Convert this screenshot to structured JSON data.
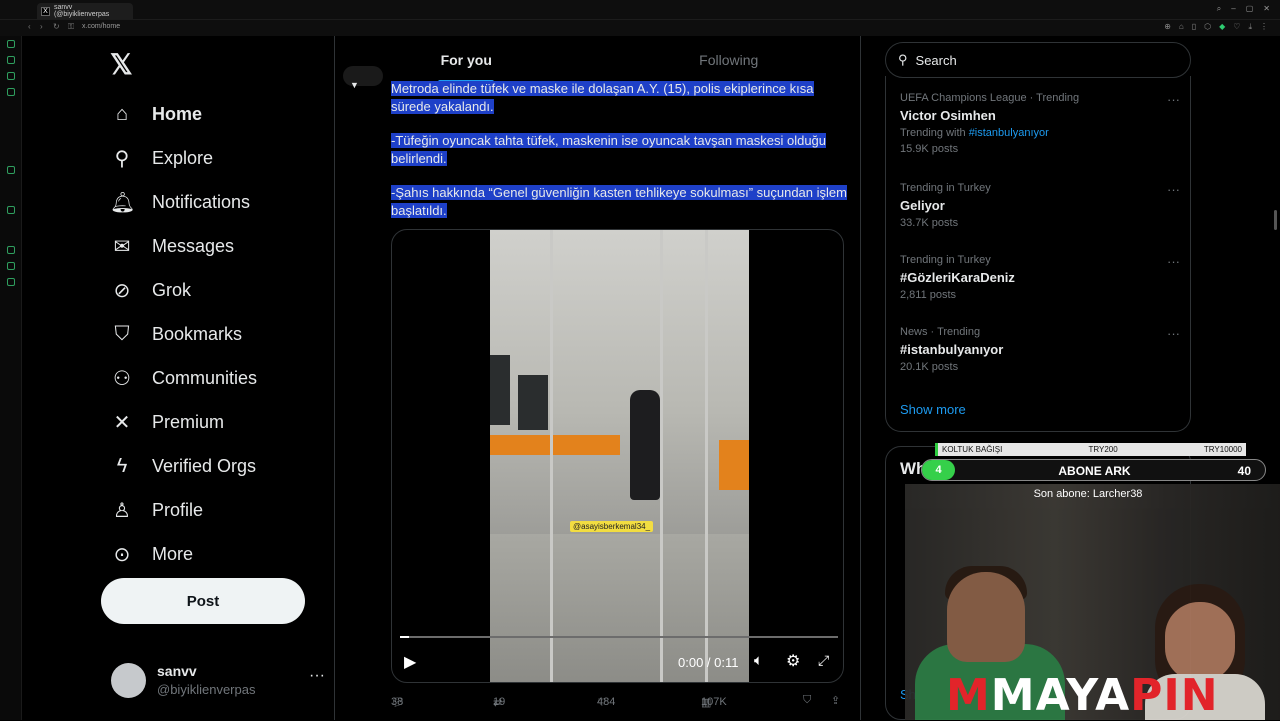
{
  "browser": {
    "tab_title": "sanvv (@biyiklienverpas",
    "tab_favicon": "x-logo",
    "address": "x.com/home"
  },
  "left_nav": {
    "logo": "𝕏",
    "items": [
      {
        "label": "Home",
        "icon": "home-icon",
        "active": true
      },
      {
        "label": "Explore",
        "icon": "search-icon"
      },
      {
        "label": "Notifications",
        "icon": "bell-icon"
      },
      {
        "label": "Messages",
        "icon": "mail-icon"
      },
      {
        "label": "Grok",
        "icon": "grok-icon"
      },
      {
        "label": "Bookmarks",
        "icon": "bookmark-icon"
      },
      {
        "label": "Communities",
        "icon": "communities-icon"
      },
      {
        "label": "Premium",
        "icon": "x-premium-icon"
      },
      {
        "label": "Verified Orgs",
        "icon": "bolt-icon"
      },
      {
        "label": "Profile",
        "icon": "person-icon"
      },
      {
        "label": "More",
        "icon": "more-circle-icon"
      }
    ],
    "post_button": "Post",
    "user": {
      "name": "sanvv",
      "handle": "@biyiklienverpas"
    }
  },
  "feed": {
    "tabs": [
      {
        "label": "For you",
        "selected": true
      },
      {
        "label": "Following",
        "selected": false
      }
    ],
    "tweet": {
      "paragraphs": [
        "Metroda elinde tüfek ve maske ile dolaşan A.Y. (15), polis ekiplerince kısa sürede yakalandı.",
        "-Tüfeğin oyuncak tahta tüfek, maskenin ise oyuncak tavşan maskesi olduğu belirlendi.",
        "-Şahıs hakkında “Genel güvenliğin kasten tehlikeye sokulması” suçundan işlem başlatıldı."
      ],
      "video": {
        "watermark": "@asayisberkemal34_",
        "time": "0:00 / 0:11",
        "progress": 0.02
      },
      "stats": {
        "replies": "38",
        "reposts": "19",
        "likes": "484",
        "views": "107K"
      }
    }
  },
  "right": {
    "search_placeholder": "Search",
    "trends": [
      {
        "context": "UEFA Champions League · Trending",
        "name": "Victor Osimhen",
        "sub_prefix": "Trending with ",
        "sub_link": "#istanbulyanıyor",
        "posts": "15.9K posts"
      },
      {
        "context": "Trending in Turkey",
        "name": "Geliyor",
        "posts": "33.7K posts"
      },
      {
        "context": "Trending in Turkey",
        "name": "#GözleriKaraDeniz",
        "posts": "2,811 posts"
      },
      {
        "context": "News · Trending",
        "name": "#istanbulyanıyor",
        "posts": "20.1K posts"
      }
    ],
    "show_more": "Show more",
    "who_to_follow_title": "Who to follow",
    "who_to_follow_show": "Sh"
  },
  "stream_overlay": {
    "bar_left": "KOLTUK BAĞIŞI",
    "bar_mid": "TRY200",
    "bar_right": "TRY10000",
    "goal_level": "4",
    "goal_label": "ABONE ARK",
    "goal_count": "40",
    "last_sub": "Son abone: Larcher38",
    "brand_m": "M",
    "brand_a": "MAYA",
    "brand_b": "PIN"
  },
  "colors": {
    "accent": "#1d9bf0",
    "selection": "#1e40c8",
    "border": "#2f3336",
    "muted": "#71767b",
    "brand_red": "#e2242a",
    "goal_green": "#35d04a"
  }
}
